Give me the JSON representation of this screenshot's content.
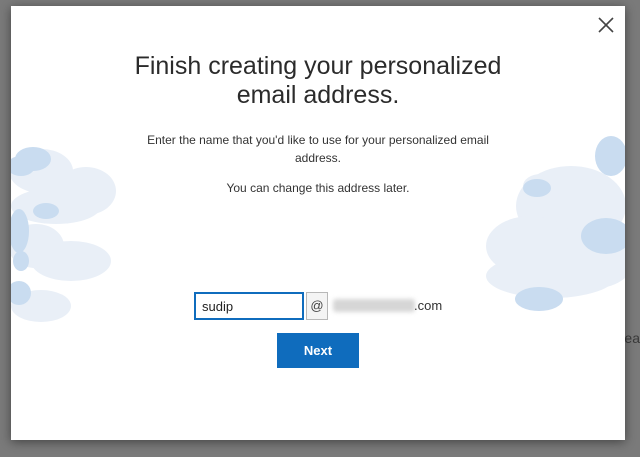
{
  "dialog": {
    "title": "Finish creating your personalized email address.",
    "description": "Enter the name that you'd like to use for your personalized email address.",
    "hint": "You can change this address later.",
    "name_value": "sudip",
    "at_symbol": "@",
    "domain_suffix": ".com",
    "next_label": "Next",
    "close_icon": "close-icon"
  },
  "background": {
    "partial_text": "ea"
  },
  "colors": {
    "accent": "#0f6cbd",
    "overlay": "#7a7a7a",
    "cloud_light": "#e8eef6",
    "cloud_blue": "#c5d9ef"
  }
}
